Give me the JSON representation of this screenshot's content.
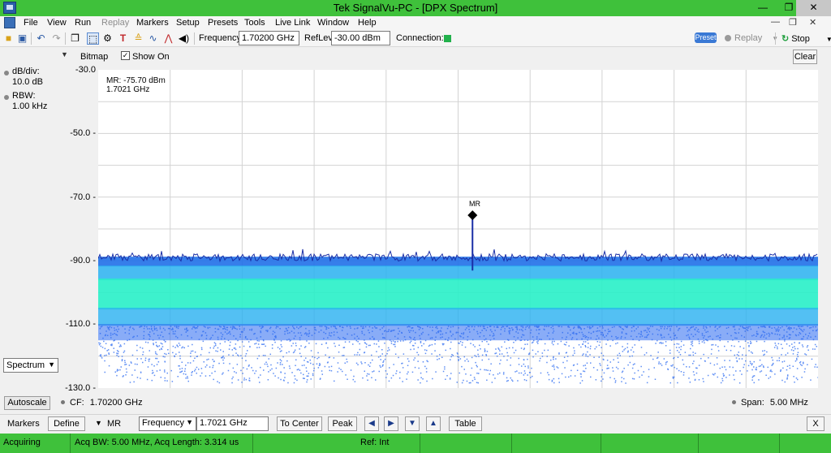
{
  "window": {
    "title": "Tek SignalVu-PC - [DPX Spectrum]",
    "min_glyph": "—",
    "max_glyph": "❐",
    "close_glyph": "✕"
  },
  "menu": {
    "items": [
      "File",
      "View",
      "Run",
      "Replay",
      "Markers",
      "Setup",
      "Presets",
      "Tools",
      "Live Link",
      "Window",
      "Help"
    ],
    "disabled": [
      "Replay"
    ],
    "mdi_min": "—",
    "mdi_restore": "❐",
    "mdi_close": "✕"
  },
  "toolbar": {
    "frequency_label": "Frequency:",
    "frequency_value": "1.70200 GHz",
    "reflev_label": "RefLev:",
    "reflev_value": "-30.00 dBm",
    "connection_label": "Connection:",
    "connection_color": "#22b14c",
    "preset_label": "Preset",
    "replay_label": "Replay",
    "stop_label": "Stop",
    "icons": [
      "open-folder-icon",
      "save-icon",
      "undo-icon",
      "redo-icon",
      "window-icon",
      "select-icon",
      "settings-icon",
      "text-tool-icon",
      "markers-icon",
      "trace-icon",
      "peak-icon",
      "audio-icon"
    ]
  },
  "left_panel": {
    "db_div_label": "dB/div:",
    "db_div_value": "10.0 dB",
    "rbw_label": "RBW:",
    "rbw_value": "1.00 kHz",
    "display_select": "Spectrum",
    "autoscale_label": "Autoscale"
  },
  "display_header": {
    "bitmap_label": "Bitmap",
    "show_label": "Show",
    "show_checked": "✓",
    "on_label": "On",
    "clear_label": "Clear"
  },
  "marker_readout": {
    "line1": "MR: -75.70 dBm",
    "line2": "1.7021 GHz",
    "marker_tag": "MR"
  },
  "plot": {
    "y_ticks": [
      "-30.0",
      "-50.0 -",
      "-70.0 -",
      "-90.0 -",
      "-110.0 -",
      "-130.0 -"
    ],
    "grid_color": "#d3d3d3"
  },
  "chart_data": {
    "type": "area",
    "title": "",
    "xlabel": "",
    "ylabel": "",
    "x_center_ghz": 1.702,
    "x_span_mhz": 5.0,
    "ylim": [
      -130,
      -30
    ],
    "y_ticks": [
      -30,
      -50,
      -70,
      -90,
      -110,
      -130
    ],
    "grid": true,
    "noise_floor_dbm": -90,
    "marker": {
      "name": "MR",
      "x_ghz": 1.7021,
      "y_dbm": -75.7
    },
    "colors": {
      "trace": "#1a2fa6",
      "density_high": "#28f0c8",
      "density_mid": "#28b0f0",
      "density_low": "#2868f0"
    }
  },
  "bottom_info": {
    "cf_label": "CF:",
    "cf_value": "1.70200 GHz",
    "span_label": "Span:",
    "span_value": "5.00 MHz"
  },
  "markerbar": {
    "markers_label": "Markers",
    "define_label": "Define",
    "marker_name": "MR",
    "measure_select": "Frequency",
    "measure_value": "1.7021 GHz",
    "to_center_label": "To Center",
    "peak_label": "Peak",
    "table_label": "Table",
    "close_label": "X",
    "arrows": [
      "◀",
      "▶",
      "▼",
      "▲"
    ]
  },
  "statusbar": {
    "state": "Acquiring",
    "acq": "Acq BW: 5.00 MHz, Acq Length: 3.314 us",
    "ref": "Ref: Int"
  }
}
